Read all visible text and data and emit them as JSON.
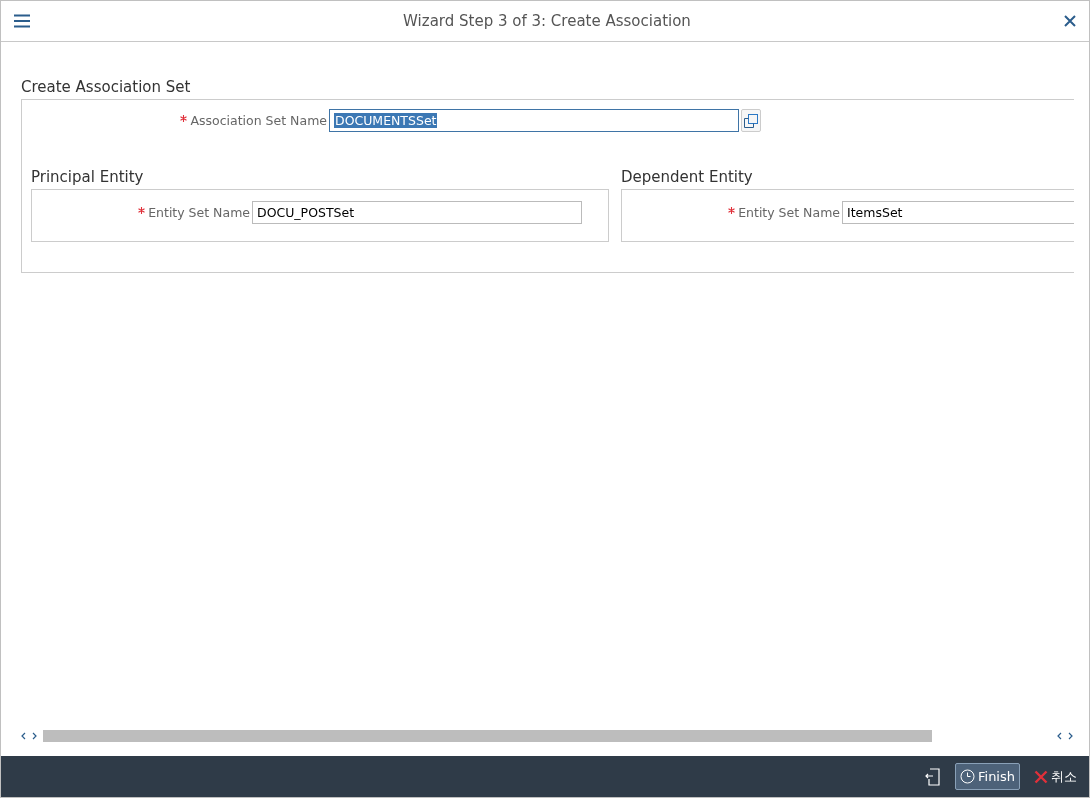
{
  "window": {
    "title": "Wizard Step 3 of 3: Create Association"
  },
  "association_set": {
    "title": "Create Association Set",
    "field": {
      "label": "Association Set Name",
      "required": true,
      "value": "DOCUMENTSSet",
      "selected": true
    }
  },
  "entities": [
    {
      "title": "Principal Entity",
      "field": {
        "label": "Entity Set Name",
        "required": true,
        "value": "DOCU_POSTSet",
        "selected": false
      }
    },
    {
      "title": "Dependent Entity",
      "field": {
        "label": "Entity Set Name",
        "required": true,
        "value": "ItemsSet",
        "selected": false
      }
    }
  ],
  "footer": {
    "buttons": [
      {
        "kind": "finish",
        "label": "Finish"
      },
      {
        "kind": "cancel",
        "label": "취소"
      }
    ]
  }
}
